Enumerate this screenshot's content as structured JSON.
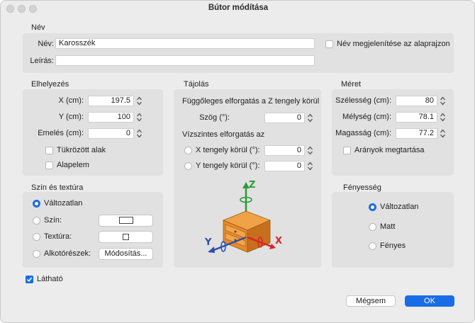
{
  "window": {
    "title": "Bútor módítása"
  },
  "name_group": {
    "title": "Név",
    "name_label": "Név:",
    "name_value": "Karosszék",
    "desc_label": "Leírás:",
    "desc_value": "",
    "show_name_label": "Név megjelenítése az alaprajzon",
    "show_name_checked": false
  },
  "placement": {
    "title": "Elhelyezés",
    "x_label": "X (cm):",
    "x_value": "197.5",
    "y_label": "Y (cm):",
    "y_value": "100",
    "elev_label": "Emelés (cm):",
    "elev_value": "0",
    "mirror_label": "Tükrözött alak",
    "mirror_checked": false,
    "base_label": "Alapelem",
    "base_checked": false
  },
  "orientation": {
    "title": "Tájolás",
    "vertical_label": "Függőleges elforgatás a Z tengely körül",
    "angle_label": "Szög (°):",
    "angle_value": "0",
    "horizontal_label": "Vízszintes elforgatás az",
    "x_axis_label": "X tengely körül (°):",
    "x_axis_value": "0",
    "y_axis_label": "Y tengely körül (°):",
    "y_axis_value": "0",
    "axis_z": "Z",
    "axis_x": "X",
    "axis_y": "Y"
  },
  "size": {
    "title": "Méret",
    "width_label": "Szélesség (cm):",
    "width_value": "80",
    "depth_label": "Mélység (cm):",
    "depth_value": "78.1",
    "height_label": "Magasság (cm):",
    "height_value": "77.2",
    "keep_ratio_label": "Arányok megtartása",
    "keep_ratio_checked": false
  },
  "color_texture": {
    "title": "Szín és textúra",
    "unchanged_label": "Változatlan",
    "color_label": "Szín:",
    "texture_label": "Textúra:",
    "parts_label": "Alkotórészek:",
    "modify_label": "Módosítás...",
    "selected": "unchanged"
  },
  "brightness": {
    "title": "Fényesség",
    "unchanged_label": "Változatlan",
    "matt_label": "Matt",
    "shiny_label": "Fényes",
    "selected": "unchanged"
  },
  "visible": {
    "label": "Látható",
    "checked": true
  },
  "buttons": {
    "cancel": "Mégsem",
    "ok": "OK"
  },
  "colors": {
    "accent": "#1a6ce6",
    "panel": "#e1e1e1",
    "window": "#ececec",
    "axis_z": "#2e9a3a",
    "axis_x": "#d9242a",
    "axis_y": "#2a4fb0"
  }
}
